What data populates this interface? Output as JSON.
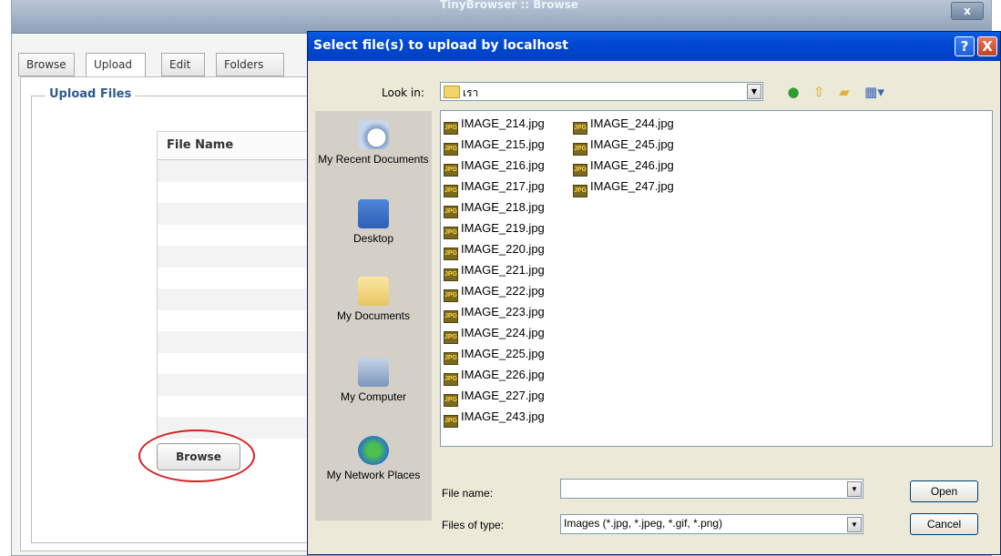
{
  "background_window": {
    "title": "TinyBrowser :: Browse",
    "close_label": "x",
    "tabs": [
      {
        "label": "Browse"
      },
      {
        "label": "Upload"
      },
      {
        "label": "Edit"
      },
      {
        "label": "Folders"
      }
    ],
    "active_tab": "Upload",
    "section_title": "Upload Files",
    "grid_header": "File Name",
    "browse_button": "Browse"
  },
  "dialog": {
    "title": "Select file(s) to upload by localhost",
    "help_label": "?",
    "close_label": "X",
    "look_in_label": "Look in:",
    "look_in_value": "เรา",
    "places": [
      {
        "label": "My Recent Documents",
        "icon": "recent-documents-icon"
      },
      {
        "label": "Desktop",
        "icon": "desktop-icon"
      },
      {
        "label": "My Documents",
        "icon": "my-documents-icon"
      },
      {
        "label": "My Computer",
        "icon": "my-computer-icon"
      },
      {
        "label": "My Network Places",
        "icon": "network-places-icon"
      }
    ],
    "files_column1": [
      "IMAGE_214.jpg",
      "IMAGE_215.jpg",
      "IMAGE_216.jpg",
      "IMAGE_217.jpg",
      "IMAGE_218.jpg",
      "IMAGE_219.jpg",
      "IMAGE_220.jpg",
      "IMAGE_221.jpg",
      "IMAGE_222.jpg",
      "IMAGE_223.jpg",
      "IMAGE_224.jpg",
      "IMAGE_225.jpg",
      "IMAGE_226.jpg",
      "IMAGE_227.jpg",
      "IMAGE_243.jpg"
    ],
    "files_column2": [
      "IMAGE_244.jpg",
      "IMAGE_245.jpg",
      "IMAGE_246.jpg",
      "IMAGE_247.jpg"
    ],
    "file_icon_text": "JPG",
    "file_name_label": "File name:",
    "file_name_value": "",
    "files_of_type_label": "Files of type:",
    "files_of_type_value": "Images (*.jpg, *.jpeg, *.gif, *.png)",
    "open_button": "Open",
    "cancel_button": "Cancel"
  },
  "colors": {
    "dialog_title_bar": "#0147d4",
    "annotation_ellipse": "#d32020",
    "section_title": "#2d5b8e"
  }
}
